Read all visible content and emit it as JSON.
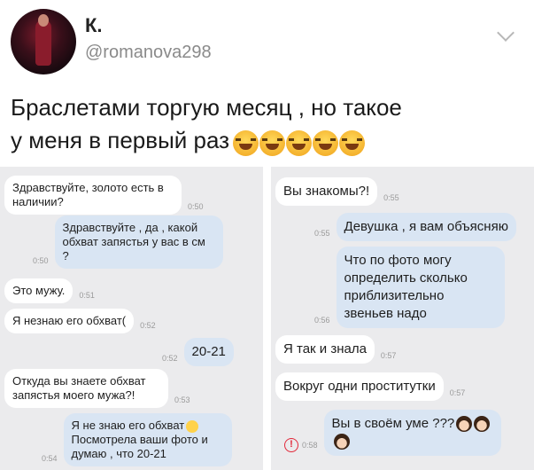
{
  "post": {
    "name": "К.",
    "handle": "@romanova298",
    "text_line1": "Браслетами торгую месяц , но такое",
    "text_line2": "у меня в первый раз"
  },
  "left_chat": [
    {
      "dir": "in",
      "text": "Здравствуйте, золото есть в наличии?",
      "time": "0:50"
    },
    {
      "dir": "out",
      "text": "Здравствуйте , да , какой обхват запястья у вас в см ?",
      "time": "0:50"
    },
    {
      "dir": "in",
      "text": "Это мужу.",
      "time": "0:51"
    },
    {
      "dir": "in",
      "text": "Я незнаю его обхват(",
      "time": "0:52"
    },
    {
      "dir": "out",
      "text": "20-21",
      "time": "0:52"
    },
    {
      "dir": "in",
      "text": "Откуда вы знаете обхват запястья моего мужа?!",
      "time": "0:53"
    },
    {
      "dir": "out",
      "text": "Я не знаю его обхват",
      "text2": "Посмотрела ваши фото и думаю , что 20-21",
      "time": "0:54"
    }
  ],
  "right_chat": [
    {
      "dir": "in",
      "text": "Вы знакомы?!",
      "time": "0:55"
    },
    {
      "dir": "out",
      "text": "Девушка , я вам объясняю",
      "time": "0:55"
    },
    {
      "dir": "out",
      "text": "Что по фото могу определить сколько приблизительно звеньев надо",
      "time": "0:56"
    },
    {
      "dir": "in",
      "text": "Я так и знала",
      "time": "0:57"
    },
    {
      "dir": "in",
      "text": "Вокруг одни проститутки",
      "time": "0:57"
    },
    {
      "dir": "out",
      "text": "Вы в своём уме ???",
      "time": "0:58",
      "error": "!"
    }
  ],
  "icons": {
    "chevron": "chevron-down-icon",
    "laugh": "laughing-face-icon",
    "error": "error-icon",
    "woman": "woman-emoji-icon",
    "sweat": "sweat-smile-icon"
  }
}
